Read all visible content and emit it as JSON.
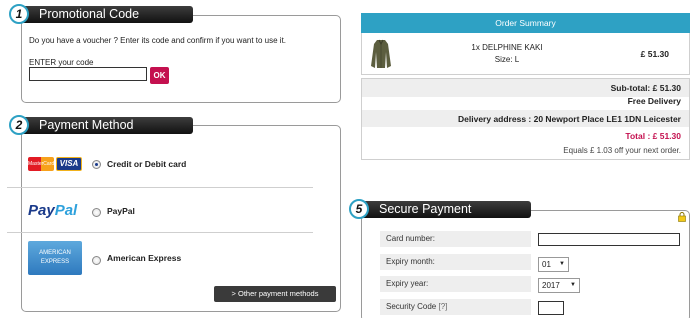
{
  "promo": {
    "step": "1",
    "title": "Promotional Code",
    "description": "Do you have a voucher ? Enter its code and confirm if you want to use it.",
    "enter_label": "ENTER your code",
    "input_value": "",
    "ok_label": "OK"
  },
  "payment": {
    "step": "2",
    "title": "Payment Method",
    "methods": [
      {
        "label": "Credit or Debit card",
        "selected": true
      },
      {
        "label": "PayPal",
        "selected": false
      },
      {
        "label": "American Express",
        "selected": false
      }
    ],
    "mastercard_text": "MasterCard",
    "visa_text": "VISA",
    "paypal_text_1": "Pay",
    "paypal_text_2": "Pal",
    "amex_text_1": "AMERICAN",
    "amex_text_2": "EXPRESS",
    "other_button": "> Other payment methods"
  },
  "summary": {
    "title": "Order Summary",
    "item_name": "1x DELPHINE KAKI",
    "item_size": "Size: L",
    "item_price": "£ 51.30",
    "subtotal": "Sub-total: £ 51.30",
    "delivery": "Free Delivery",
    "address": "Delivery address : 20 Newport Place LE1 1DN Leicester",
    "total": "Total : £ 51.30",
    "note": "Equals £ 1.03 off your next order."
  },
  "secure": {
    "step": "5",
    "title": "Secure Payment",
    "card_number_label": "Card number:",
    "expiry_month_label": "Expiry month:",
    "expiry_month_value": "01",
    "expiry_year_label": "Expiry year:",
    "expiry_year_value": "2017",
    "cvv_label": "Security Code",
    "cvv_help": "[?]"
  },
  "colors": {
    "accent": "#2ea1c4",
    "brand": "#c4104f",
    "tab": "#1a1a1a"
  }
}
